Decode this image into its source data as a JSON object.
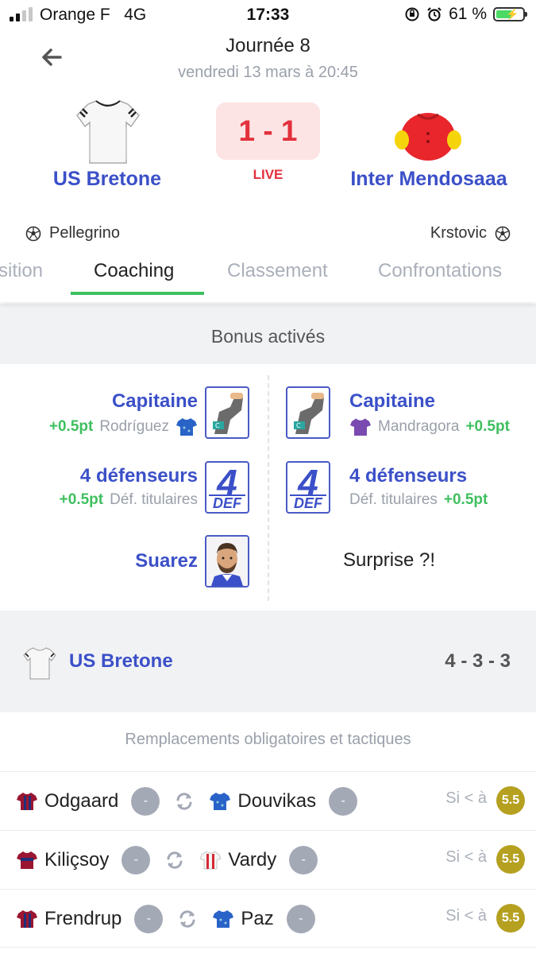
{
  "status_bar": {
    "carrier": "Orange F",
    "network": "4G",
    "time": "17:33",
    "battery": "61 %",
    "battery_level": 0.61
  },
  "header": {
    "round": "Journée 8",
    "date": "vendredi 13 mars à 20:45"
  },
  "match": {
    "home": {
      "name": "US Bretone",
      "scorer": "Pellegrino"
    },
    "away": {
      "name": "Inter Mendosaaa",
      "scorer": "Krstovic"
    },
    "score": "1 - 1",
    "status": "LIVE"
  },
  "tabs": [
    {
      "label": "sition",
      "active": false
    },
    {
      "label": "Coaching",
      "active": true
    },
    {
      "label": "Classement",
      "active": false
    },
    {
      "label": "Confrontations",
      "active": false
    }
  ],
  "bonus": {
    "heading": "Bonus activés",
    "home": [
      {
        "title": "Capitaine",
        "points": "+0.5pt",
        "detail": "Rodríguez"
      },
      {
        "title": "4 défenseurs",
        "points": "+0.5pt",
        "detail": "Déf. titulaires"
      },
      {
        "title": "Suarez"
      }
    ],
    "away": [
      {
        "title": "Capitaine",
        "points": "+0.5pt",
        "detail": "Mandragora"
      },
      {
        "title": "4 défenseurs",
        "points": "+0.5pt",
        "detail": "Déf. titulaires"
      },
      {
        "title": "Surprise ?!"
      }
    ],
    "def_card": {
      "number": "4",
      "text": "DEF"
    }
  },
  "team_band": {
    "name": "US Bretone",
    "formation": "4 - 3 - 3"
  },
  "replacements": {
    "heading": "Remplacements obligatoires et tactiques",
    "rows": [
      {
        "out": "Odgaard",
        "out_grade": "-",
        "in": "Douvikas",
        "in_grade": "-",
        "condition": "Si < à",
        "threshold": "5.5"
      },
      {
        "out": "Kiliçsoy",
        "out_grade": "-",
        "in": "Vardy",
        "in_grade": "-",
        "condition": "Si < à",
        "threshold": "5.5"
      },
      {
        "out": "Frendrup",
        "out_grade": "-",
        "in": "Paz",
        "in_grade": "-",
        "condition": "Si < à",
        "threshold": "5.5"
      }
    ]
  },
  "colors": {
    "accent": "#3b50c8",
    "live": "#e2303c",
    "positive": "#3fbf5f",
    "threshold": "#b5a020"
  }
}
